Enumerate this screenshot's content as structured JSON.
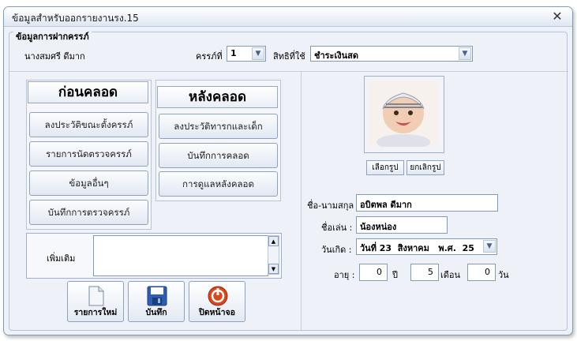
{
  "window": {
    "title": "ข้อมูลสำหรับออกรายงานรง.15"
  },
  "group": {
    "title": "ข้อมูลการฝากครรภ์"
  },
  "header": {
    "mother_name": "นางสมศรี ดีมาก",
    "pregnancy_label": "ครรภ์ที่",
    "pregnancy_value": "1",
    "rights_label": "สิทธิที่ใช้",
    "rights_value": "ชำระเงินสด"
  },
  "before_birth": {
    "title": "ก่อนคลอด",
    "buttons": [
      "ลงประวัติขณะตั้งครรภ์",
      "รายการนัดตรวจครรภ์",
      "ข้อมูลอื่นๆ",
      "บันทึกการตรวจครรภ์"
    ]
  },
  "after_birth": {
    "title": "หลังคลอด",
    "buttons": [
      "ลงประวัติทารกและเด็ก",
      "บันทึกการคลอด",
      "การดูแลหลังคลอด"
    ]
  },
  "memo": {
    "label": "เพิ่มเติม",
    "value": ""
  },
  "toolbar": {
    "new_label": "รายการใหม่",
    "save_label": "บันทึก",
    "close_label": "ปิดหน้าจอ"
  },
  "photo": {
    "choose_label": "เลือกรูป",
    "cancel_label": "ยกเลิกรูป"
  },
  "child": {
    "name_label": "ชื่อ-นามสกุล :",
    "name_value": "อบิตพล ดีมาก",
    "nickname_label": "ชื่อเล่น :",
    "nickname_value": "น้องหน่อง",
    "birthdate_label": "วันเกิด :",
    "birthdate_value": "วันที่ 23  สิงหาคม   พ.ศ.  25",
    "age_label": "อายุ :",
    "age_years": "0",
    "years_unit": "ปี",
    "age_months": "5",
    "months_unit": "เดือน",
    "age_days": "0",
    "days_unit": "วัน"
  },
  "icons": {
    "close": "close-icon",
    "dropdown": "chevron-down-icon",
    "new": "document-icon",
    "save": "floppy-disk-icon",
    "exit": "power-icon",
    "photo": "baby-photo"
  }
}
